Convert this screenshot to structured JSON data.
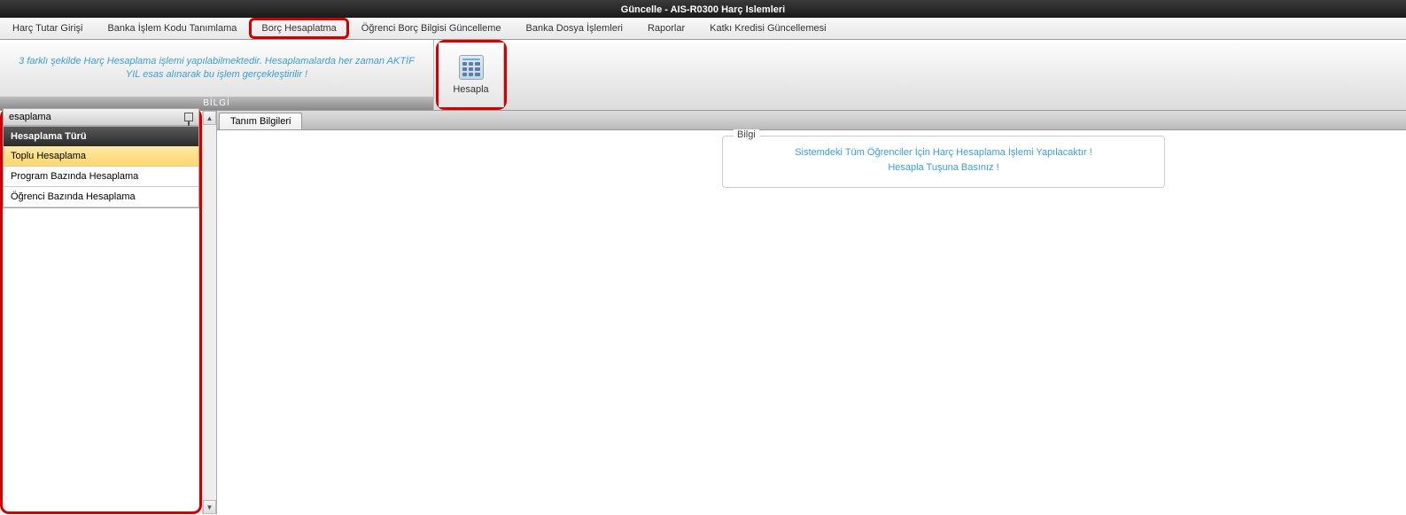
{
  "title_bar": "Güncelle - AIS-R0300 Harç Islemleri",
  "menu": {
    "items": [
      "Harç Tutar Girişi",
      "Banka İşlem Kodu Tanımlama",
      "Borç Hesaplatma",
      "Öğrenci Borç Bilgisi Güncelleme",
      "Banka Dosya İşlemleri",
      "Raporlar",
      "Katkı Kredisi Güncellemesi"
    ],
    "highlighted_index": 2
  },
  "ribbon": {
    "info_text": "3 farklı şekilde Harç Hesaplama işlemi yapılabilmektedir. Hesaplamalarda her zaman AKTİF YIL esas alınarak bu işlem gerçekleştirilir !",
    "info_label": "BİLGİ",
    "action_label": "Hesapla"
  },
  "sidebar": {
    "title": "esaplama",
    "header": "Hesaplama Türü",
    "items": [
      "Toplu Hesaplama",
      "Program Bazında Hesaplama",
      "Öğrenci Bazında Hesaplama"
    ],
    "selected_index": 0
  },
  "main": {
    "tab": "Tanım Bilgileri",
    "fieldset_legend": "Bilgi",
    "fieldset_msg_line1": "Sistemdeki Tüm Öğrenciler İçin Harç Hesaplama İşlemi Yapılacaktır !",
    "fieldset_msg_line2": "Hesapla Tuşuna Basınız !"
  }
}
